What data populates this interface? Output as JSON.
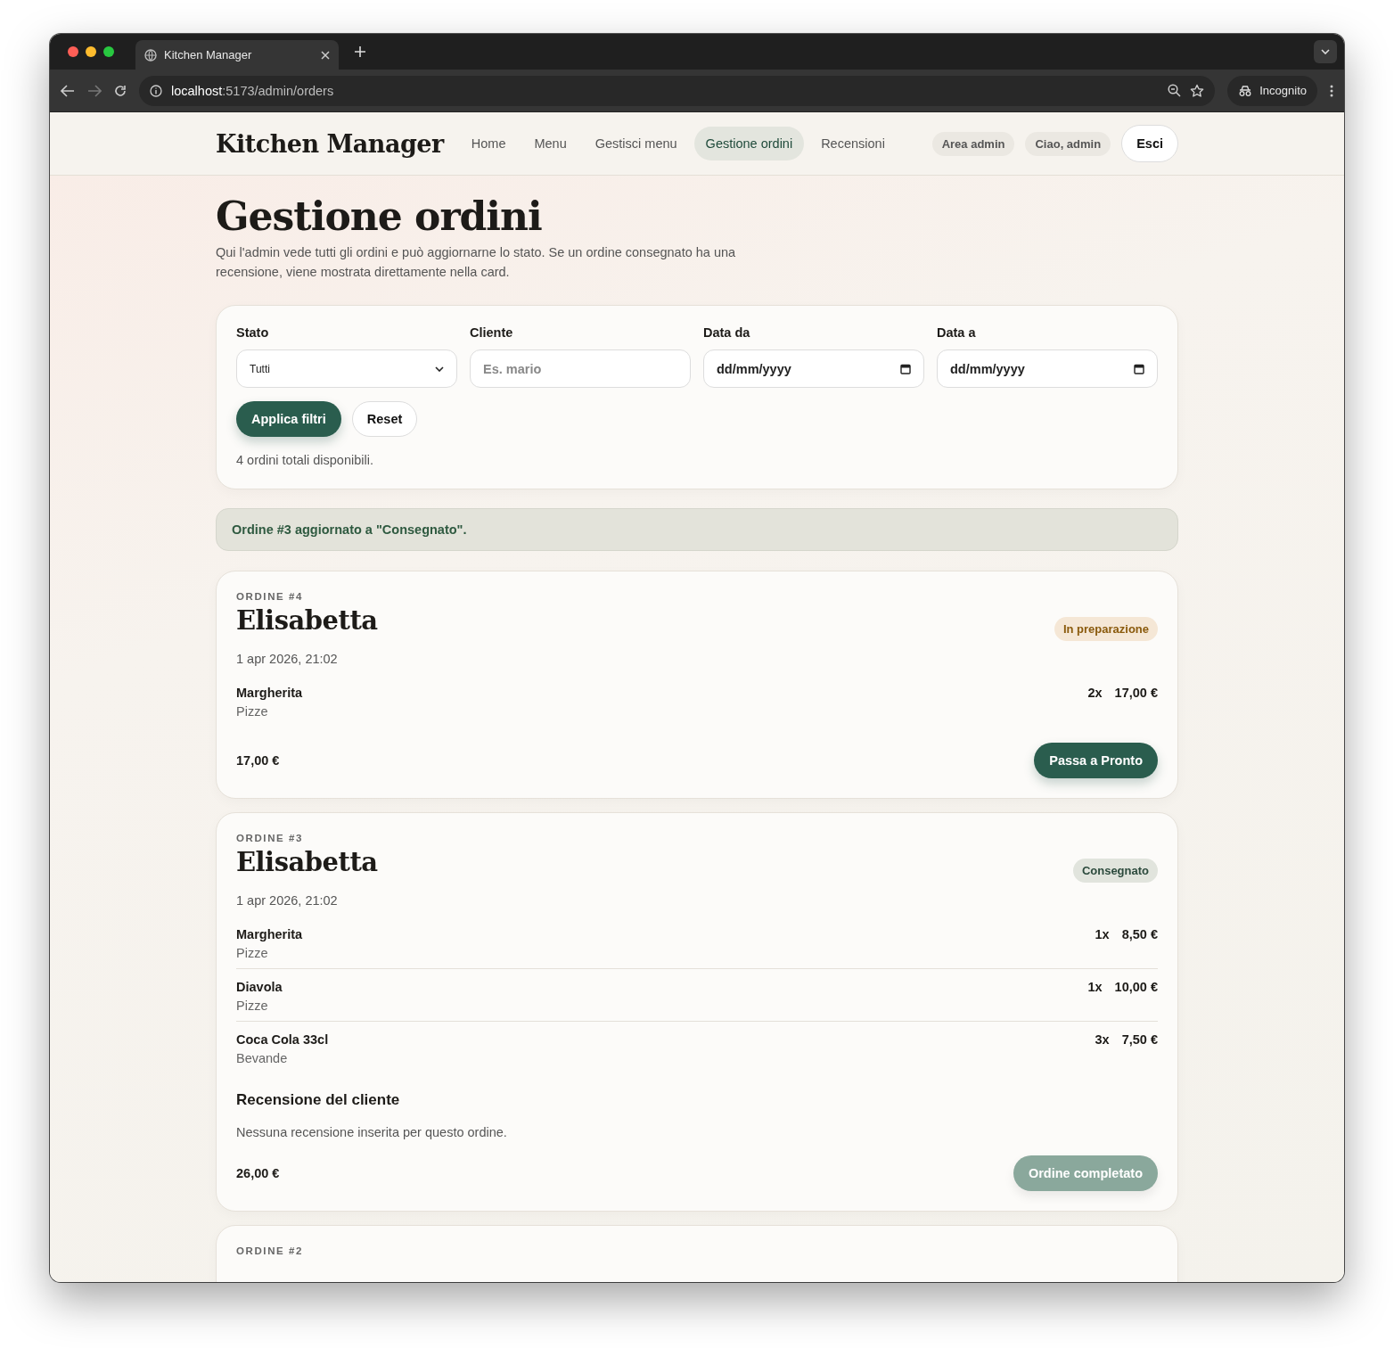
{
  "browser": {
    "tab_title": "Kitchen Manager",
    "url_host": "localhost",
    "url_path": ":5173/admin/orders",
    "profile": "Incognito"
  },
  "nav": {
    "brand": "Kitchen Manager",
    "links": [
      {
        "label": "Home",
        "selected": false
      },
      {
        "label": "Menu",
        "selected": false
      },
      {
        "label": "Gestisci menu",
        "selected": false
      },
      {
        "label": "Gestione ordini",
        "selected": true
      },
      {
        "label": "Recensioni",
        "selected": false
      }
    ],
    "chips": [
      "Area admin",
      "Ciao, admin"
    ],
    "logout": "Esci"
  },
  "page": {
    "title": "Gestione ordini",
    "intro": "Qui l'admin vede tutti gli ordini e può aggiornarne lo stato. Se un ordine consegnato ha una recensione, viene mostrata direttamente nella card."
  },
  "filters": {
    "fields": [
      {
        "kind": "select",
        "label": "Stato",
        "value": "Tutti"
      },
      {
        "kind": "text",
        "label": "Cliente",
        "placeholder": "Es. mario"
      },
      {
        "kind": "date",
        "label": "Data da",
        "value": "dd/mm/yyyy"
      },
      {
        "kind": "date",
        "label": "Data a",
        "value": "dd/mm/yyyy"
      }
    ],
    "apply": "Applica filtri",
    "reset": "Reset",
    "summary": "4 ordini totali disponibili."
  },
  "notice": "Ordine #3 aggiornato a \"Consegnato\".",
  "orders": [
    {
      "label": "ORDINE #4",
      "customer": "Elisabetta",
      "date": "1 apr 2026, 21:02",
      "status": {
        "label": "In preparazione",
        "kind": "preparing"
      },
      "items": [
        {
          "name": "Margherita",
          "category": "Pizze",
          "qty": "2x",
          "price": "17,00 €"
        }
      ],
      "total": "17,00 €",
      "action": {
        "label": "Passa a Pronto",
        "disabled": false
      }
    },
    {
      "label": "ORDINE #3",
      "customer": "Elisabetta",
      "date": "1 apr 2026, 21:02",
      "status": {
        "label": "Consegnato",
        "kind": "delivered"
      },
      "items": [
        {
          "name": "Margherita",
          "category": "Pizze",
          "qty": "1x",
          "price": "8,50 €"
        },
        {
          "name": "Diavola",
          "category": "Pizze",
          "qty": "1x",
          "price": "10,00 €"
        },
        {
          "name": "Coca Cola 33cl",
          "category": "Bevande",
          "qty": "3x",
          "price": "7,50 €"
        }
      ],
      "review": {
        "title": "Recensione del cliente",
        "text": "Nessuna recensione inserita per questo ordine."
      },
      "total": "26,00 €",
      "action": {
        "label": "Ordine completato",
        "disabled": true
      }
    },
    {
      "label": "ORDINE #2"
    }
  ]
}
